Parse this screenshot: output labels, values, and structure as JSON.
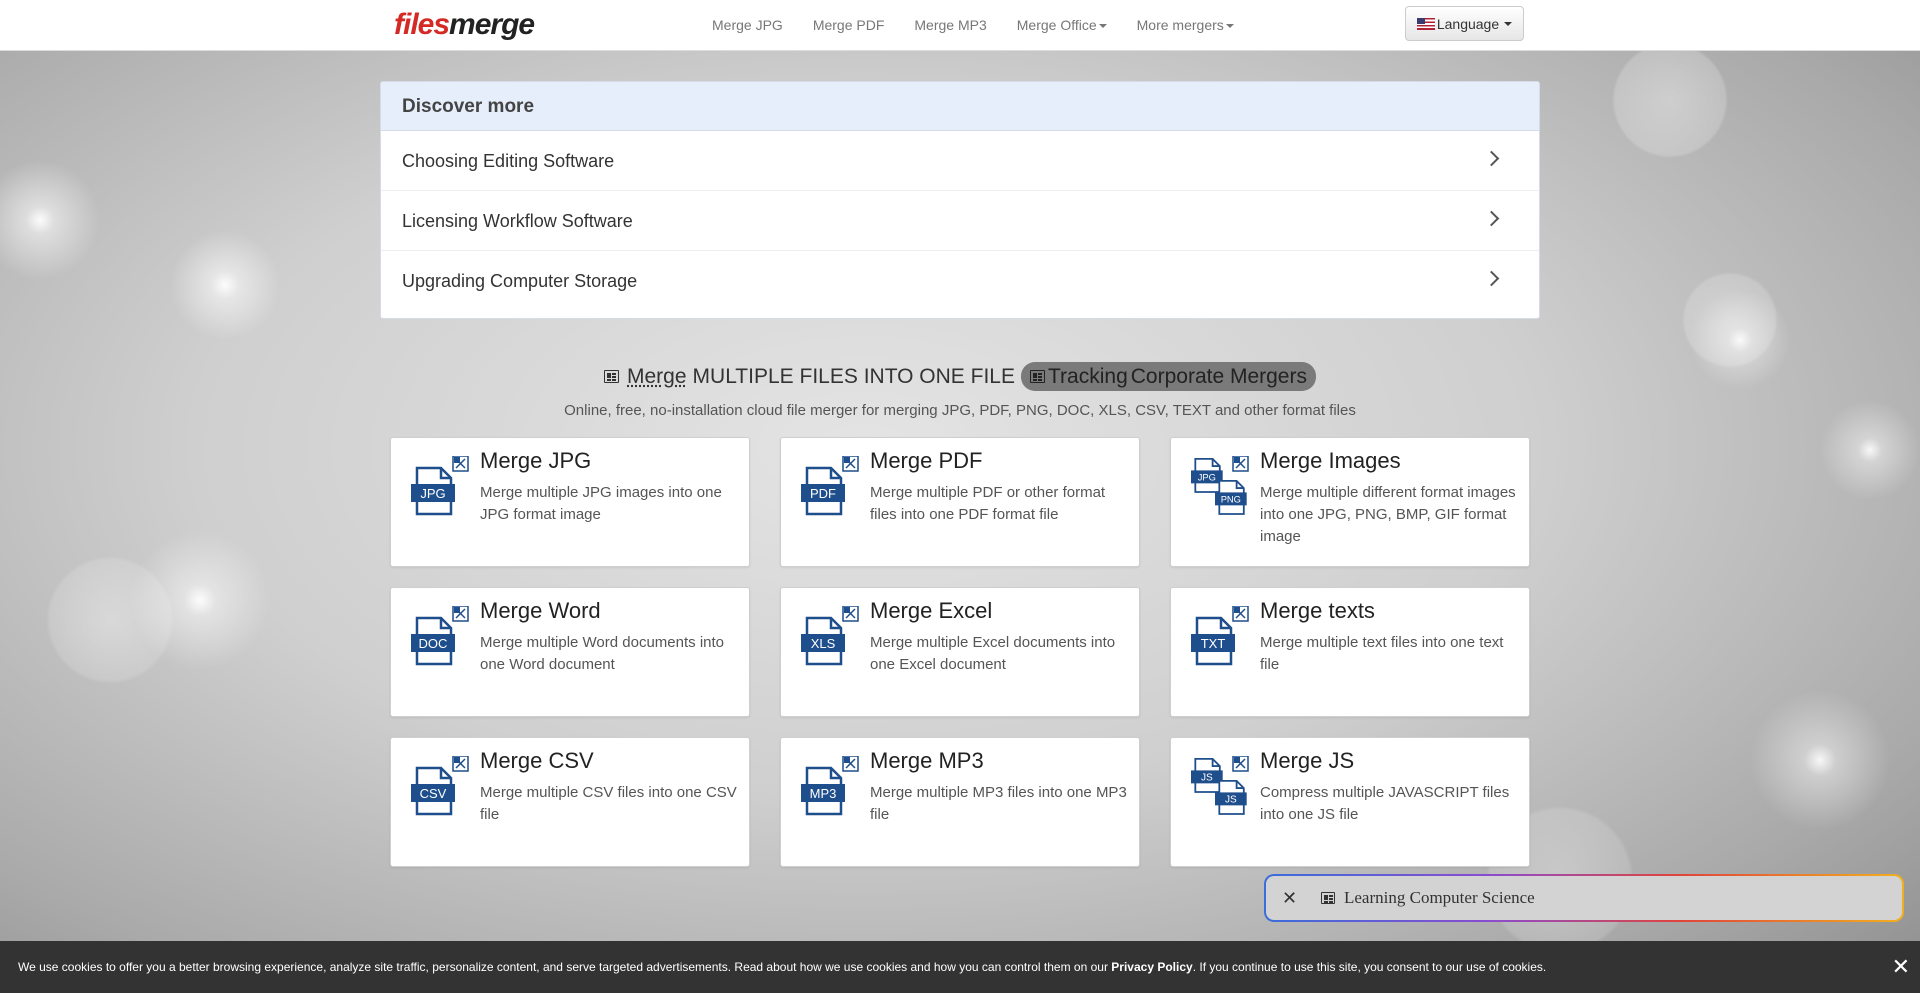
{
  "navbar": {
    "logo_part1": "files",
    "logo_part2": "merge",
    "links": [
      "Merge JPG",
      "Merge PDF",
      "Merge MP3",
      "Merge Office",
      "More mergers"
    ],
    "language_label": "Language"
  },
  "discover": {
    "title": "Discover more",
    "items": [
      "Choosing Editing Software",
      "Licensing Workflow Software",
      "Upgrading Computer Storage"
    ]
  },
  "heading": {
    "merge_word": "Merge",
    "rest": "MULTIPLE FILES INTO ONE FILE",
    "pill_word1": "Tracking",
    "pill_word2": "Corporate Mergers",
    "subtitle": "Online, free, no-installation cloud file merger for merging JPG, PDF, PNG, DOC, XLS, CSV, TEXT and other format files"
  },
  "cards": [
    {
      "title": "Merge JPG",
      "desc": "Merge multiple JPG images into one JPG format image",
      "icon": "jpg-file-icon",
      "label": "JPG"
    },
    {
      "title": "Merge PDF",
      "desc": "Merge multiple PDF or other format files into one PDF format file",
      "icon": "pdf-file-icon",
      "label": "PDF"
    },
    {
      "title": "Merge Images",
      "desc": "Merge multiple different format images into one JPG, PNG, BMP, GIF format image",
      "icon": "images-file-icon",
      "label": "JPG",
      "label2": "PNG"
    },
    {
      "title": "Merge Word",
      "desc": "Merge multiple Word documents into one Word document",
      "icon": "doc-file-icon",
      "label": "DOC"
    },
    {
      "title": "Merge Excel",
      "desc": "Merge multiple Excel documents into one Excel document",
      "icon": "xls-file-icon",
      "label": "XLS"
    },
    {
      "title": "Merge texts",
      "desc": "Merge multiple text files into one text file",
      "icon": "txt-file-icon",
      "label": "TXT"
    },
    {
      "title": "Merge CSV",
      "desc": "Merge multiple CSV files into one CSV file",
      "icon": "csv-file-icon",
      "label": "CSV"
    },
    {
      "title": "Merge MP3",
      "desc": "Merge multiple MP3 files into one MP3 file",
      "icon": "mp3-file-icon",
      "label": "MP3"
    },
    {
      "title": "Merge JS",
      "desc": "Compress multiple JAVASCRIPT files into one JS file",
      "icon": "js-file-icon",
      "label": "JS",
      "label2": "JS"
    }
  ],
  "float_bar": {
    "close": "✕",
    "text": "Learning Computer Science"
  },
  "cookie": {
    "text_before": "We use cookies to offer you a better browsing experience, analyze site traffic, personalize content, and serve targeted advertisements. Read about how we use cookies and how you can control them on our ",
    "link": "Privacy Policy",
    "text_after": ". If you continue to use this site, you consent to our use of cookies.",
    "close": "✕"
  },
  "colors": {
    "icon_blue": "#1f4e8c",
    "logo_red": "#d42a26",
    "cookie_bg": "#333333",
    "discover_head_bg": "#e6eefc"
  }
}
